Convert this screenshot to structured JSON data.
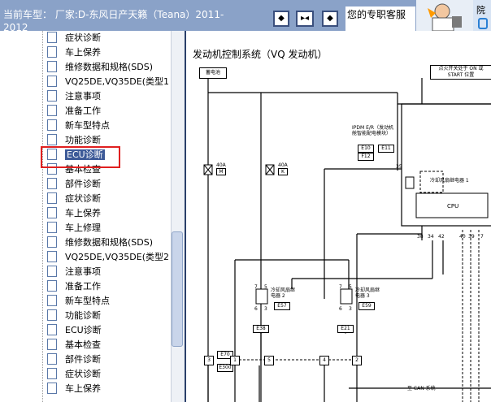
{
  "header": {
    "title": "当前车型： 厂家:D-东风日产天籁（Teana）2011-2012",
    "nav_first": "◆",
    "nav_center": "▸◂",
    "nav_last": "◆",
    "promo_text": "您的专职客服",
    "right_text": "院"
  },
  "sidebar": {
    "items": [
      {
        "label": "症状诊断"
      },
      {
        "label": "车上保养"
      },
      {
        "label": "维修数据和规格(SDS)"
      },
      {
        "label": "VQ25DE,VQ35DE(类型1"
      },
      {
        "label": "注意事项"
      },
      {
        "label": "准备工作"
      },
      {
        "label": "新车型特点"
      },
      {
        "label": "功能诊断"
      },
      {
        "label": "ECU诊断"
      },
      {
        "label": "基本检查"
      },
      {
        "label": "部件诊断"
      },
      {
        "label": "症状诊断"
      },
      {
        "label": "车上保养"
      },
      {
        "label": "车上修理"
      },
      {
        "label": "维修数据和规格(SDS)"
      },
      {
        "label": "VQ25DE,VQ35DE(类型2"
      },
      {
        "label": "注意事项"
      },
      {
        "label": "准备工作"
      },
      {
        "label": "新车型特点"
      },
      {
        "label": "功能诊断"
      },
      {
        "label": "ECU诊断"
      },
      {
        "label": "基本检查"
      },
      {
        "label": "部件诊断"
      },
      {
        "label": "症状诊断"
      },
      {
        "label": "车上保养"
      }
    ],
    "selected_index": 8
  },
  "diagram": {
    "title": "发动机控制系统（VQ 发动机）",
    "battery": "蓄电池",
    "ignition": "点火开关处于 ON 或 START 位置",
    "ipdm": "IPDM E/R（发动机舱智能配电模块）",
    "ipdm_codes": [
      "E10",
      "E11",
      "F12"
    ],
    "fuse1": "40A",
    "fuse1_id": "M",
    "fuse2": "40A",
    "fuse2_id": "K",
    "pin_35": "35",
    "relay1": "冷却风扇继电器 1",
    "relay2": "冷却风扇继电器 2",
    "relay3": "冷却风扇继电器 3",
    "relay2_code": "E57",
    "relay3_code": "E59",
    "ground1": "E38",
    "ground2": "E21",
    "cpu": "CPU",
    "pins": [
      "38",
      "34",
      "42",
      "40",
      "39",
      "7"
    ],
    "connector_codes": [
      "E70",
      "E300"
    ],
    "connector_numbers": [
      "3",
      "1",
      "5",
      "4",
      "2"
    ],
    "relay2_pins": [
      "7",
      "5",
      "6",
      "3"
    ],
    "relay3_pins": [
      "7",
      "5",
      "6",
      "3"
    ],
    "can": "至 CAN 系统"
  }
}
